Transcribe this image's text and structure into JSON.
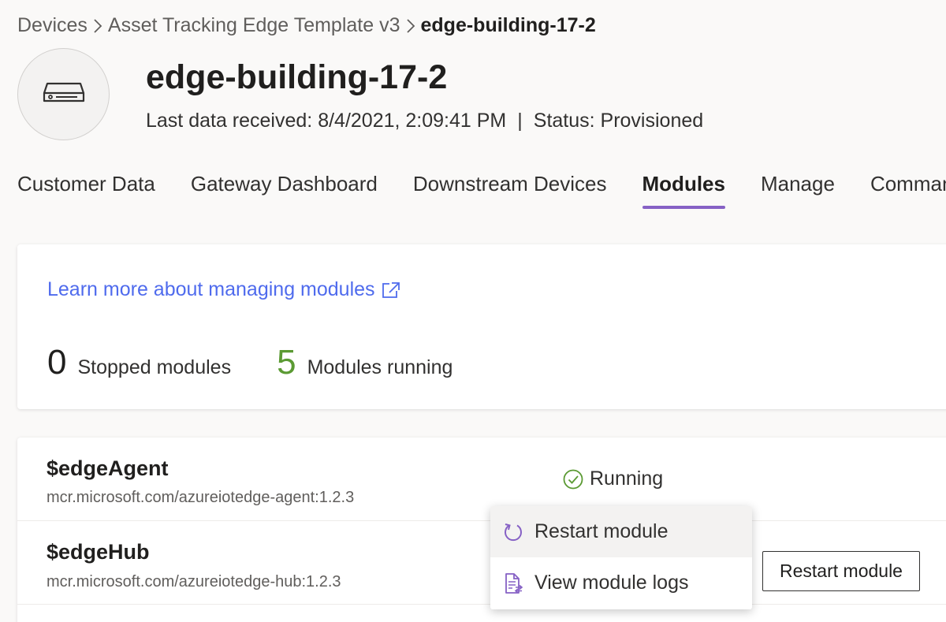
{
  "breadcrumb": {
    "items": [
      "Devices",
      "Asset Tracking Edge Template v3",
      "edge-building-17-2"
    ]
  },
  "device": {
    "icon": "edge-device-icon",
    "name": "edge-building-17-2",
    "last_data_label": "Last data received: 8/4/2021, 2:09:41 PM",
    "separator": "|",
    "status_label": "Status: Provisioned"
  },
  "tabs": [
    {
      "label": "Customer Data",
      "active": false
    },
    {
      "label": "Gateway Dashboard",
      "active": false
    },
    {
      "label": "Downstream Devices",
      "active": false
    },
    {
      "label": "Modules",
      "active": true
    },
    {
      "label": "Manage",
      "active": false
    },
    {
      "label": "Commands",
      "active": false
    }
  ],
  "summary": {
    "learn_link": "Learn more about managing modules",
    "stopped_count": "0",
    "stopped_label": "Stopped modules",
    "running_count": "5",
    "running_label": "Modules running"
  },
  "modules": [
    {
      "name": "$edgeAgent",
      "image": "mcr.microsoft.com/azureiotedge-agent:1.2.3",
      "status": "Running"
    },
    {
      "name": "$edgeHub",
      "image": "mcr.microsoft.com/azureiotedge-hub:1.2.3",
      "status": ""
    }
  ],
  "context_menu": {
    "items": [
      {
        "label": "Restart module",
        "icon": "restart-icon"
      },
      {
        "label": "View module logs",
        "icon": "logs-icon"
      }
    ]
  },
  "row_action": {
    "label": "Restart module"
  },
  "colors": {
    "accent": "#8661c5",
    "link": "#4f6bed",
    "running": "#5b9a33"
  }
}
